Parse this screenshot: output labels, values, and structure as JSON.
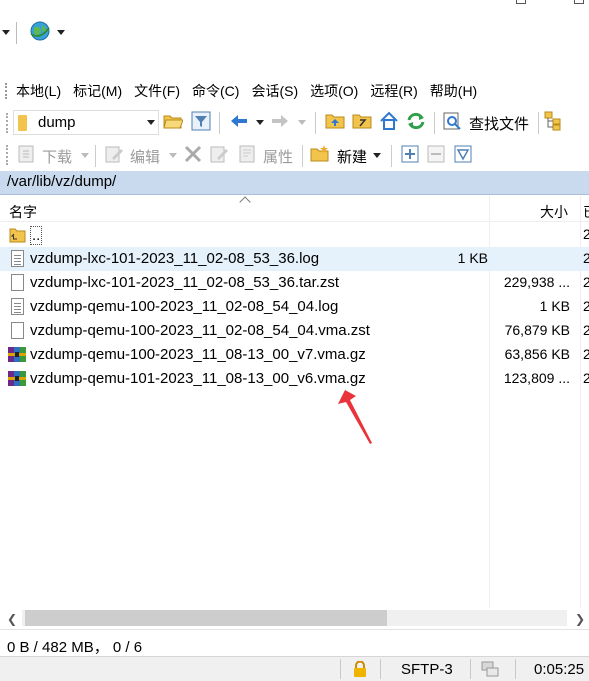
{
  "menubar": {
    "items": [
      "本地(L)",
      "标记(M)",
      "文件(F)",
      "命令(C)",
      "会话(S)",
      "选项(O)",
      "远程(R)",
      "帮助(H)"
    ]
  },
  "toolbar": {
    "dir_combo_value": "dump",
    "find_files_label": "查找文件",
    "download_label": "下载",
    "edit_label": "编辑",
    "properties_label": "属性",
    "new_label": "新建"
  },
  "path": "/var/lib/vz/dump/",
  "file_list": {
    "header_name": "名字",
    "header_size": "大小",
    "header_date": "已",
    "parent_label": "..",
    "rows": [
      {
        "name": "vzdump-lxc-101-2023_11_02-08_53_36.log",
        "size": "1 KB",
        "date": "2",
        "icon": "log-file-icon",
        "selected": true
      },
      {
        "name": "vzdump-lxc-101-2023_11_02-08_53_36.tar.zst",
        "size": "229,938 ...",
        "date": "2",
        "icon": "file-icon",
        "selected": false
      },
      {
        "name": "vzdump-qemu-100-2023_11_02-08_54_04.log",
        "size": "1 KB",
        "date": "2",
        "icon": "log-file-icon",
        "selected": false
      },
      {
        "name": "vzdump-qemu-100-2023_11_02-08_54_04.vma.zst",
        "size": "76,879 KB",
        "date": "2",
        "icon": "file-icon",
        "selected": false
      },
      {
        "name": "vzdump-qemu-100-2023_11_08-13_00_v7.vma.gz",
        "size": "63,856 KB",
        "date": "2",
        "icon": "archive-icon",
        "selected": false
      },
      {
        "name": "vzdump-qemu-101-2023_11_08-13_00_v6.vma.gz",
        "size": "123,809 ...",
        "date": "2",
        "icon": "archive-icon",
        "selected": false
      }
    ],
    "parent_date": "2"
  },
  "status": {
    "summary": "0 B / 482 MB， 0 / 6",
    "protocol": "SFTP-3",
    "elapsed": "0:05:25"
  },
  "colors": {
    "path_bar": "#c9d9ee",
    "selection": "#e5f1fb",
    "annotation_arrow": "#e8343a"
  }
}
